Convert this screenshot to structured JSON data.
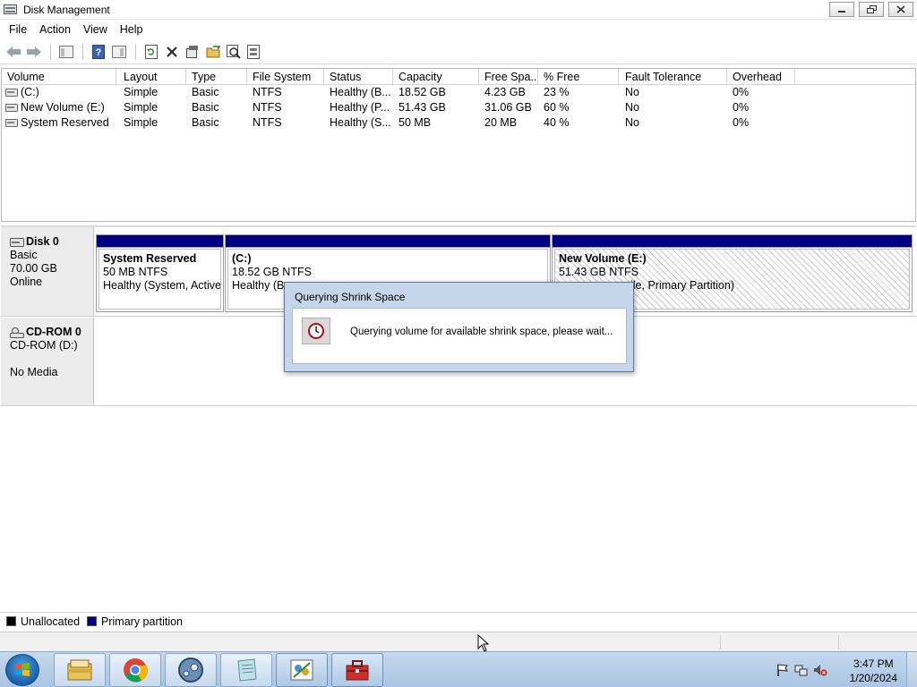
{
  "window": {
    "title": "Disk Management"
  },
  "menu": [
    "File",
    "Action",
    "View",
    "Help"
  ],
  "toolbar_icons": [
    "back-arrow-icon",
    "forward-arrow-icon",
    "console-tree-icon",
    "help-icon",
    "properties-icon",
    "refresh-icon",
    "delete-icon",
    "settings-icon",
    "folder-open-icon",
    "magnifier-icon",
    "disk-icon"
  ],
  "volume_table": {
    "columns": [
      "Volume",
      "Layout",
      "Type",
      "File System",
      "Status",
      "Capacity",
      "Free Spa...",
      "% Free",
      "Fault Tolerance",
      "Overhead"
    ],
    "rows": [
      [
        "(C:)",
        "Simple",
        "Basic",
        "NTFS",
        "Healthy (B...",
        "18.52 GB",
        "4.23 GB",
        "23 %",
        "No",
        "0%"
      ],
      [
        "New Volume (E:)",
        "Simple",
        "Basic",
        "NTFS",
        "Healthy (P...",
        "51.43 GB",
        "31.06 GB",
        "60 %",
        "No",
        "0%"
      ],
      [
        "System Reserved",
        "Simple",
        "Basic",
        "NTFS",
        "Healthy (S...",
        "50 MB",
        "20 MB",
        "40 %",
        "No",
        "0%"
      ]
    ]
  },
  "disks": [
    {
      "name": "Disk 0",
      "type": "Basic",
      "size": "70.00 GB",
      "state": "Online",
      "partitions": [
        {
          "name": "System Reserved",
          "size": "50 MB NTFS",
          "status": "Healthy (System, Active,"
        },
        {
          "name": "(C:)",
          "size": "18.52 GB NTFS",
          "status": "Healthy (Bo"
        },
        {
          "name": "New Volume  (E:)",
          "size": "51.43 GB NTFS",
          "status": "ile, Primary Partition)"
        }
      ]
    },
    {
      "name": "CD-ROM 0",
      "type": "CD-ROM (D:)",
      "state": "No Media"
    }
  ],
  "legend": [
    {
      "label": "Unallocated",
      "color": "#000000"
    },
    {
      "label": "Primary partition",
      "color": "#00007e"
    }
  ],
  "dialog": {
    "title": "Querying Shrink Space",
    "message": "Querying volume for available shrink space, please wait..."
  },
  "taskbar": {
    "apps": [
      "file-explorer-icon",
      "chrome-icon",
      "steam-icon",
      "notepad-icon",
      "paint-icon",
      "toolbox-icon"
    ],
    "time": "3:47 PM",
    "date": "1/20/2024"
  },
  "colors": {
    "primary_partition": "#00007e",
    "dialog_frame": "#c6d6ea",
    "taskbar": "#b9d0e8"
  }
}
